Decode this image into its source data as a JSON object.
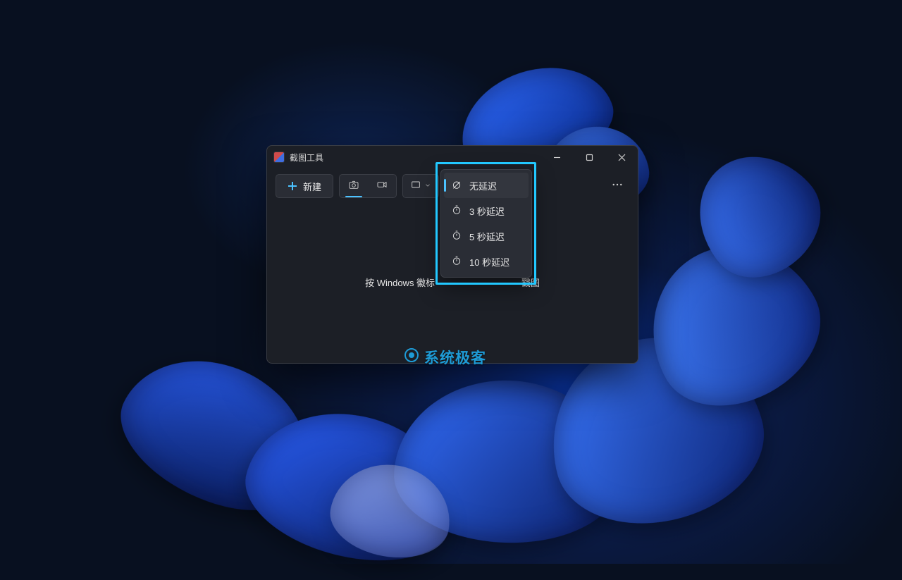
{
  "window": {
    "title": "截图工具"
  },
  "toolbar": {
    "new_label": "新建"
  },
  "content": {
    "hint_prefix": "按 Windows 徽标",
    "hint_suffix": "戳图"
  },
  "delay_menu": {
    "items": [
      {
        "label": "无延迟"
      },
      {
        "label": "3 秒延迟"
      },
      {
        "label": "5 秒延迟"
      },
      {
        "label": "10 秒延迟"
      }
    ]
  },
  "watermark": {
    "text": "系统极客"
  }
}
